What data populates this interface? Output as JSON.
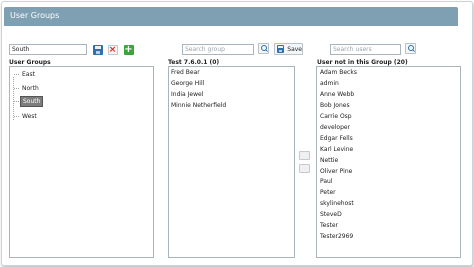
{
  "header": {
    "title": "User Groups"
  },
  "group_editor": {
    "name_value": "South"
  },
  "group_search": {
    "placeholder": "Search group"
  },
  "save_label": "Save",
  "user_search": {
    "placeholder": "Search users"
  },
  "user_groups": {
    "title": "User Groups",
    "items": [
      "East",
      "North",
      "South",
      "West"
    ],
    "selected": "South"
  },
  "group_members": {
    "title": "Test 7.6.0.1 (0)",
    "items": [
      "Fred Bear",
      "George Hill",
      "India Jewel",
      "Minnie Netherfield"
    ]
  },
  "not_in_group": {
    "title": "User not in this Group (20)",
    "items": [
      "Adam Becks",
      "admin",
      "Anne Webb",
      "Bob Jones",
      "Carrie Osp",
      "developer",
      "Edgar Fells",
      "Karl Levine",
      "Nettie",
      "Oliver Pine",
      "Paul",
      "Peter",
      "skylinehost",
      "SteveD",
      "Tester",
      "Tester2969"
    ]
  },
  "icons": {
    "save": "save-icon",
    "delete": "delete-icon",
    "add": "add-icon",
    "search": "search-icon"
  }
}
